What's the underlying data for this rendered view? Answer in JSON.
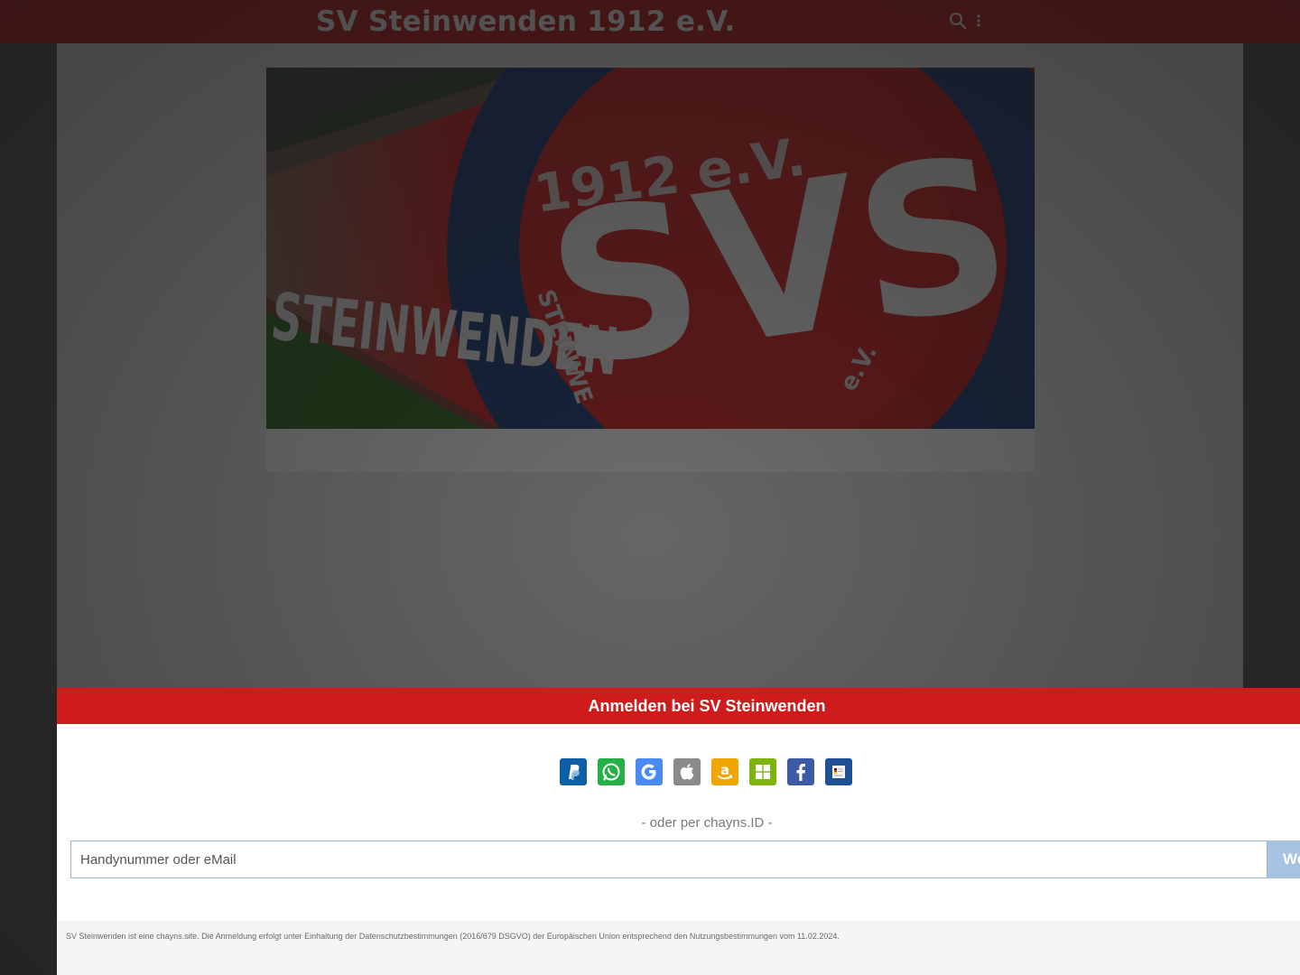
{
  "header": {
    "site_title": "SV Steinwenden 1912 e.V.",
    "search_icon": "search-icon",
    "menu_icon": "more-vertical-icon"
  },
  "hero": {
    "banner_text_top": "1912 e.V.",
    "banner_text_main": "STEINWENDEN",
    "logo_letters": "SVS",
    "ring_text_left": "STEINWE",
    "ring_text_right": "e.V."
  },
  "login": {
    "title": "Anmelden bei SV Steinwenden",
    "providers": [
      {
        "name": "paypal-icon",
        "color": "#0f5fa6"
      },
      {
        "name": "whatsapp-icon",
        "color": "#25b045"
      },
      {
        "name": "google-icon",
        "color": "#4a8af4"
      },
      {
        "name": "apple-icon",
        "color": "#8a8a8a"
      },
      {
        "name": "amazon-icon",
        "color": "#f0a500"
      },
      {
        "name": "windows-icon",
        "color": "#7db40d"
      },
      {
        "name": "facebook-icon",
        "color": "#3b5ba7"
      },
      {
        "name": "id-card-icon",
        "color": "#1f4f94"
      }
    ],
    "divider": "- oder per chayns.ID -",
    "input_placeholder": "Handynummer oder eMail",
    "next_label": "We",
    "legal": "SV Steinwenden ist eine chayns.site. Die Anmeldung erfolgt unter Einhaltung der Datenschutzbestimmungen (2016/679 DSGVO) der Europäischen Union entsprechend den Nutzungsbestimmungen vom 11.02.2024."
  },
  "colors": {
    "brand_red": "#ce1c1c",
    "button_blue": "#a7c3e4"
  }
}
